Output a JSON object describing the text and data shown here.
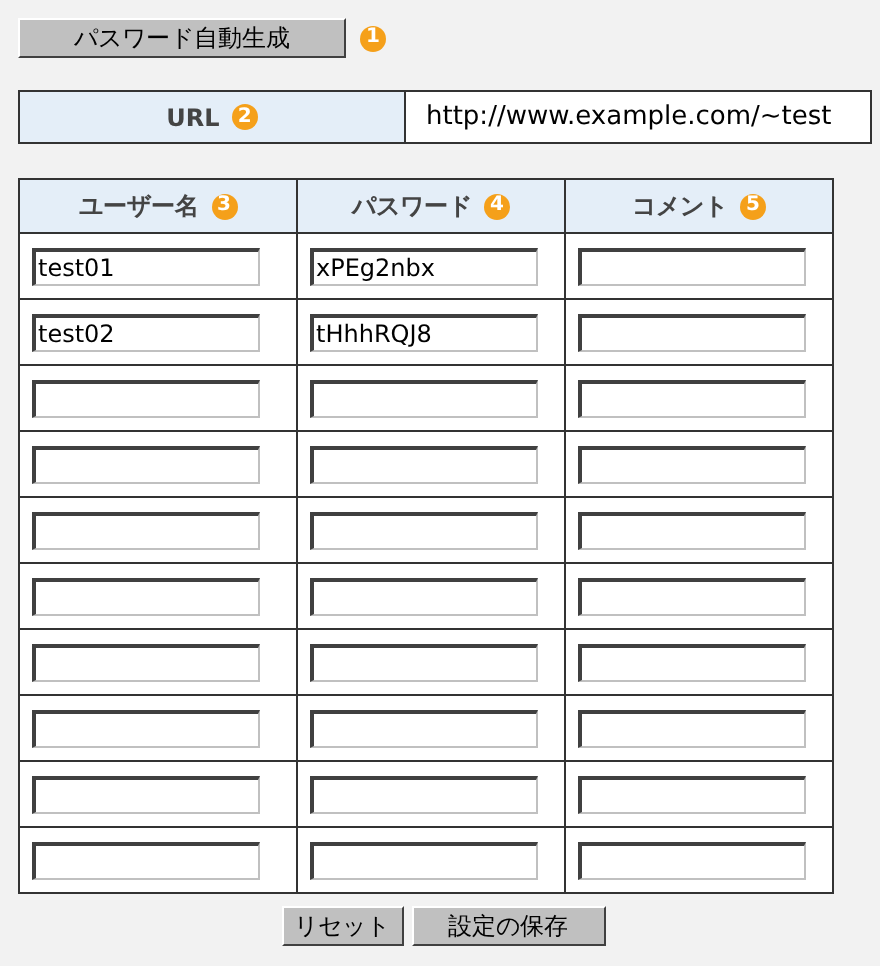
{
  "generate_button": {
    "label": "パスワード自動生成",
    "badge": "1"
  },
  "url": {
    "label": "URL",
    "badge": "2",
    "value": "http://www.example.com/~test"
  },
  "table": {
    "columns": [
      {
        "label": "ユーザー名",
        "badge": "3"
      },
      {
        "label": "パスワード",
        "badge": "4"
      },
      {
        "label": "コメント",
        "badge": "5"
      }
    ],
    "rows": [
      {
        "username": "test01",
        "password": "xPEg2nbx"
      },
      {
        "username": "test02",
        "password": "tHhhRQJ8"
      },
      {},
      {},
      {},
      {},
      {},
      {},
      {},
      {}
    ]
  },
  "buttons": [
    {
      "label": "リセット"
    },
    {
      "label": "設定の保存"
    }
  ]
}
